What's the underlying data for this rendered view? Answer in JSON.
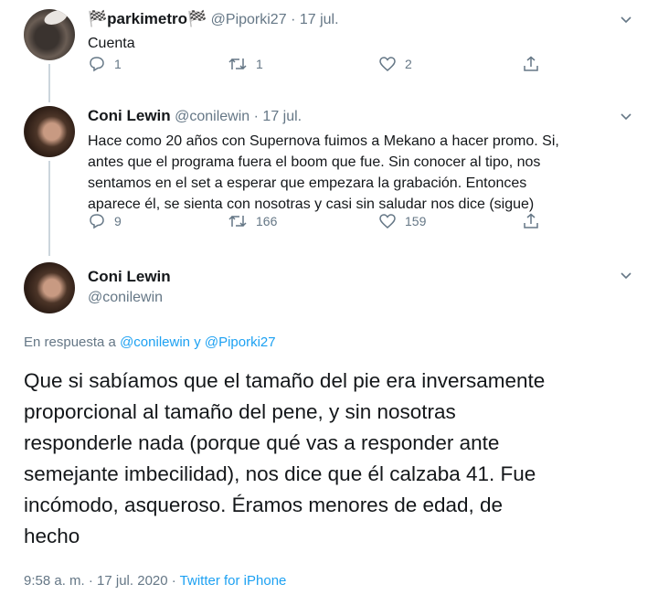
{
  "tweets": [
    {
      "name": "🏁parkimetro🏁",
      "handle": "@Piporki27",
      "date": "· 17 jul.",
      "text": "Cuenta",
      "replies": "1",
      "retweets": "1",
      "likes": "2"
    },
    {
      "name": "Coni Lewin",
      "handle": "@conilewin",
      "date": "· 17 jul.",
      "lines": [
        "Hace como 20 años con Supernova fuimos a Mekano a hacer promo. Si,",
        "antes que el programa fuera el boom que fue. Sin conocer al tipo, nos",
        "sentamos en el set a esperar que empezara la grabación. Entonces",
        "aparece él, se sienta con nosotras y casi sin saludar nos dice (sigue)"
      ],
      "replies": "9",
      "retweets": "166",
      "likes": "159"
    }
  ],
  "main": {
    "name": "Coni Lewin",
    "handle": "@conilewin",
    "reply_prefix": "En respuesta a",
    "reply_user1": "@conilewin",
    "reply_and": "y",
    "reply_user2": "@Piporki27",
    "lines": [
      "Que si sabíamos que el tamaño del pie era inversamente",
      "proporcional al tamaño del pene, y sin nosotras",
      "responderle nada (porque qué vas a responder ante",
      "semejante imbecilidad), nos dice que él calzaba 41. Fue",
      "incómodo, asqueroso. Éramos menores de edad, de",
      "hecho"
    ],
    "time": "9:58 a. m. · 17 jul. 2020 ·",
    "source": "Twitter for iPhone"
  },
  "icons": [
    "reply-icon",
    "retweet-icon",
    "like-icon",
    "share-icon",
    "chevron-down-icon"
  ]
}
